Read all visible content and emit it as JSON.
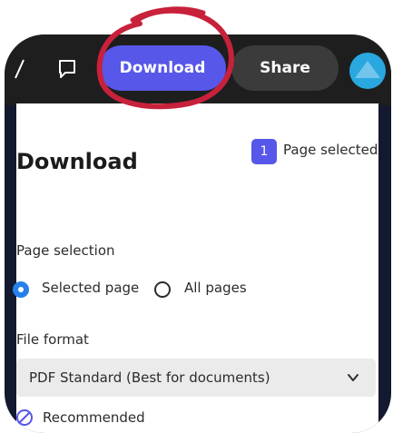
{
  "toolbar": {
    "download_label": "Download",
    "share_label": "Share"
  },
  "panel": {
    "title": "Download",
    "page_count": "1",
    "page_selected_label": "Page selected",
    "page_selection": {
      "label": "Page selection",
      "options": [
        "Selected page",
        "All pages"
      ],
      "selected": "Selected page"
    },
    "file_format": {
      "label": "File format",
      "value": "PDF Standard (Best for documents)"
    },
    "recommended_label": "Recommended"
  },
  "colors": {
    "accent": "#5757ea",
    "annotation": "#c8213b",
    "frame": "#13192f"
  },
  "icons": [
    "comment-icon",
    "chevron-down-icon",
    "check-circle-icon"
  ]
}
